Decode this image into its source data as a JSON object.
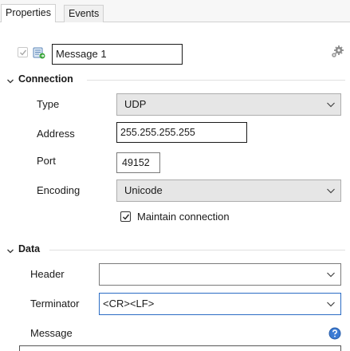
{
  "tabs": [
    {
      "label": "Properties",
      "active": true
    },
    {
      "label": "Events",
      "active": false
    }
  ],
  "message": {
    "name": "Message 1",
    "enabled": true
  },
  "sections": {
    "connection": {
      "title": "Connection",
      "type_label": "Type",
      "type_value": "UDP",
      "address_label": "Address",
      "address_value": "255.255.255.255",
      "port_label": "Port",
      "port_value": "49152",
      "encoding_label": "Encoding",
      "encoding_value": "Unicode",
      "maintain_label": "Maintain connection",
      "maintain_checked": true
    },
    "data": {
      "title": "Data",
      "header_label": "Header",
      "header_value": "",
      "terminator_label": "Terminator",
      "terminator_value": "<CR><LF>",
      "message_label": "Message"
    }
  },
  "icons": [
    "message-icon",
    "settings-gear-icon",
    "help-icon",
    "chevron-down-icon",
    "collapse-chevron-icon"
  ],
  "colors": {
    "accent": "#2b6cc4",
    "field_border": "#7a7a7a",
    "select_bg": "#e6e6e6"
  }
}
